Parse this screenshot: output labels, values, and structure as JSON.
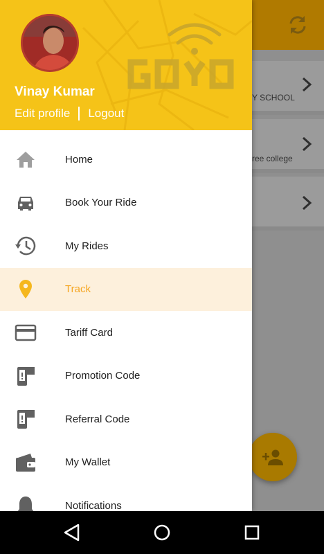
{
  "background": {
    "rows": [
      {
        "text": "Y SCHOOL"
      },
      {
        "text": "ree college"
      },
      {
        "text": ""
      }
    ]
  },
  "drawer": {
    "user_name": "Vinay Kumar",
    "edit_profile": "Edit profile",
    "logout": "Logout",
    "logo_text": "GOYO",
    "menu": [
      {
        "label": "Home",
        "icon": "home-icon"
      },
      {
        "label": "Book Your Ride",
        "icon": "car-icon"
      },
      {
        "label": "My Rides",
        "icon": "history-icon"
      },
      {
        "label": "Track",
        "icon": "location-pin-icon",
        "active": true
      },
      {
        "label": "Tariff Card",
        "icon": "card-icon"
      },
      {
        "label": "Promotion Code",
        "icon": "promo-code-icon"
      },
      {
        "label": "Referral Code",
        "icon": "referral-code-icon"
      },
      {
        "label": "My Wallet",
        "icon": "wallet-icon"
      },
      {
        "label": "Notifications",
        "icon": "bell-icon"
      }
    ]
  },
  "colors": {
    "accent": "#f5c318",
    "active_text": "#f5a623",
    "active_bg": "#fdf0dc"
  }
}
